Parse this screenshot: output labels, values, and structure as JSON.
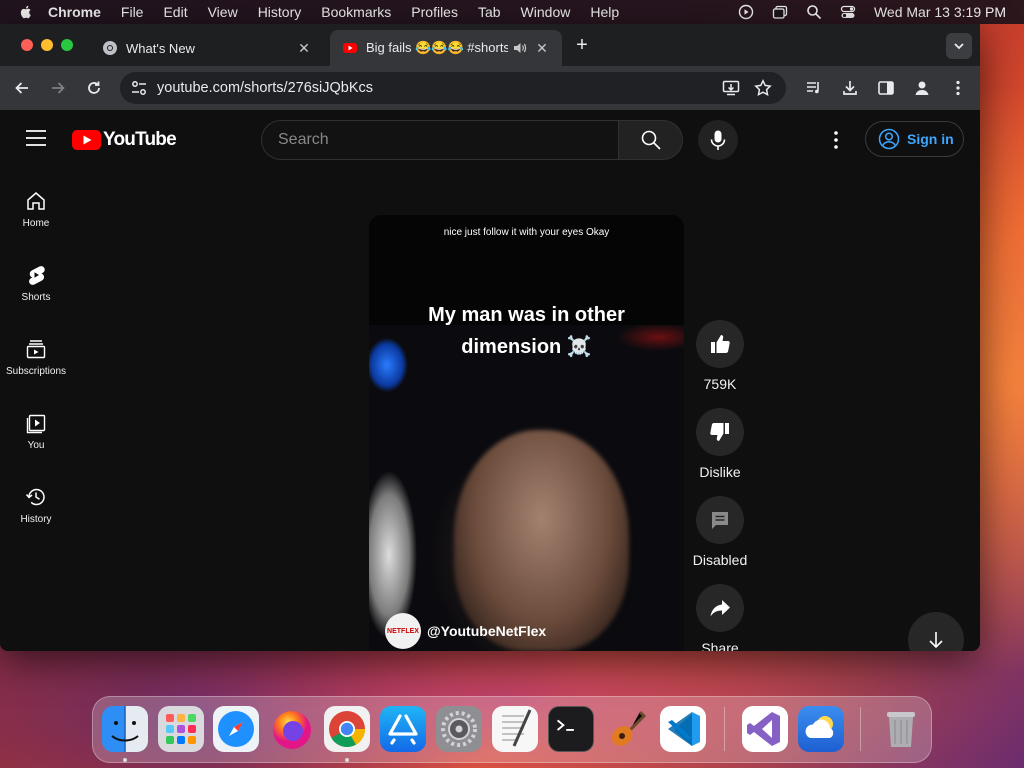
{
  "menubar": {
    "app_name": "Chrome",
    "menus": [
      "File",
      "Edit",
      "View",
      "History",
      "Bookmarks",
      "Profiles",
      "Tab",
      "Window",
      "Help"
    ],
    "clock": "Wed Mar 13  3:19 PM"
  },
  "tabs": [
    {
      "title": "What's New",
      "active": false,
      "favicon": "chrome-icon"
    },
    {
      "title": "Big fails 😂😂😂 #shortsf",
      "active": true,
      "favicon": "youtube-icon"
    }
  ],
  "toolbar": {
    "url": "youtube.com/shorts/276siJQbKcs"
  },
  "youtube": {
    "logo_text": "YouTube",
    "search_placeholder": "Search",
    "sign_in_label": "Sign in",
    "guide": [
      {
        "label": "Home",
        "icon": "home-icon"
      },
      {
        "label": "Shorts",
        "icon": "shorts-icon"
      },
      {
        "label": "Subscriptions",
        "icon": "subscriptions-icon"
      },
      {
        "label": "You",
        "icon": "you-icon"
      },
      {
        "label": "History",
        "icon": "history-icon"
      }
    ],
    "short": {
      "caption_top": "nice just follow it with your eyes Okay",
      "caption_main": "My man was in other dimension ☠️",
      "channel_handle": "@YoutubeNetFlex",
      "avatar_text": "NETFLEX"
    },
    "actions": {
      "like": "759K",
      "dislike": "Dislike",
      "comments": "Disabled",
      "share": "Share"
    }
  },
  "colors": {
    "yt_red": "#ff0000",
    "link_blue": "#3ea6ff",
    "yt_bg": "#0f0f0f"
  },
  "dock": [
    "Finder",
    "Launchpad",
    "Safari",
    "Firefox",
    "Google Chrome",
    "App Store",
    "System Settings",
    "TextEdit",
    "Terminal",
    "GarageBand",
    "Visual Studio Code",
    "Visual Studio",
    "Weather",
    "Trash"
  ]
}
